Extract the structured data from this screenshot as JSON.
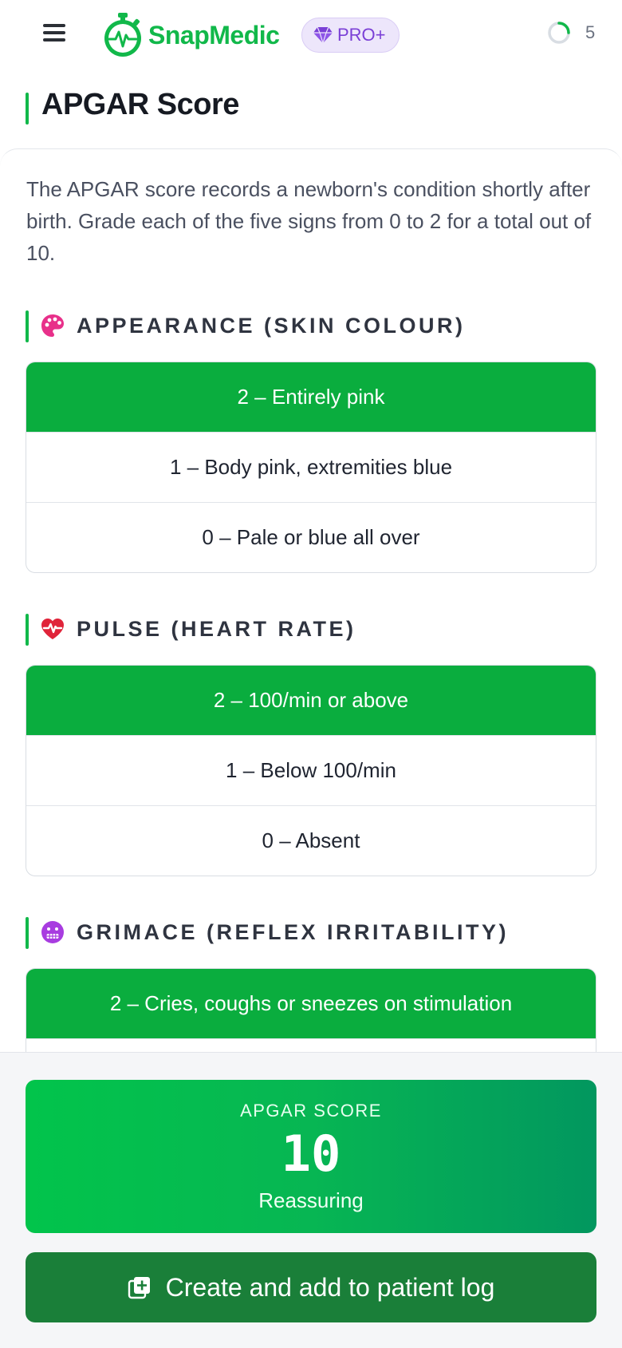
{
  "header": {
    "brand": "SnapMedic",
    "pro_badge": "PRO+",
    "counter": "5"
  },
  "page": {
    "title": "APGAR Score",
    "intro": "The APGAR score records a newborn's condition shortly after birth. Grade each of the five signs from 0 to 2 for a total out of 10."
  },
  "sections": [
    {
      "title": "APPEARANCE (SKIN COLOUR)",
      "icon": "palette-icon",
      "options": [
        "2 – Entirely pink",
        "1 – Body pink, extremities blue",
        "0 – Pale or blue all over"
      ],
      "selected": 0
    },
    {
      "title": "PULSE (HEART RATE)",
      "icon": "heart-pulse-icon",
      "options": [
        "2 – 100/min or above",
        "1 – Below 100/min",
        "0 – Absent"
      ],
      "selected": 0
    },
    {
      "title": "GRIMACE (REFLEX IRRITABILITY)",
      "icon": "grimace-face-icon",
      "options": [
        "2 – Cries, coughs or sneezes on stimulation"
      ],
      "selected": 0
    }
  ],
  "result": {
    "label": "APGAR SCORE",
    "value": "10",
    "interpretation": "Reassuring"
  },
  "actions": {
    "log_button": "Create and add to patient log"
  },
  "colors": {
    "brand_green": "#11b84a",
    "selected_option": "#0aad3e",
    "log_button": "#1a7f39",
    "pro_purple": "#7a3fd6"
  }
}
